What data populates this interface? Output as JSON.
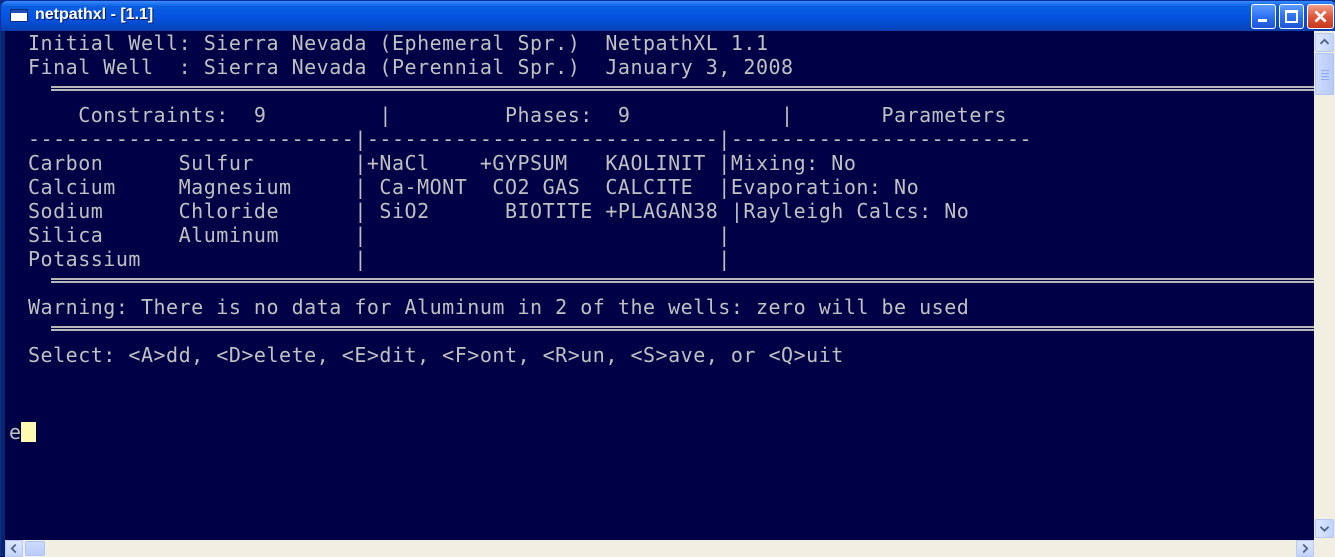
{
  "window": {
    "title": "netpathxl - [1.1]"
  },
  "console": {
    "lines": [
      "Initial Well: Sierra Nevada (Ephemeral Spr.)  NetpathXL 1.1",
      "Final Well  : Sierra Nevada (Perennial Spr.)  January 3, 2008",
      "=",
      "    Constraints:  9         |         Phases:  9            |       Parameters",
      "--------------------------|----------------------------|------------------------",
      "Carbon      Sulfur        |+NaCl    +GYPSUM   KAOLINIT |Mixing: No",
      "Calcium     Magnesium     | Ca-MONT  CO2 GAS  CALCITE  |Evaporation: No",
      "Sodium      Chloride      | SiO2      BIOTITE +PLAGAN38 |Rayleigh Calcs: No",
      "Silica      Aluminum      |                            |",
      "Potassium                 |                            |",
      "=",
      "Warning: There is no data for Aluminum in 2 of the wells: zero will be used",
      "=",
      "Select: <A>dd, <D>elete, <E>dit, <F>ont, <R>un, <S>ave, or <Q>uit"
    ],
    "prompt_input": "e"
  },
  "icons": {
    "app": "console-window-icon",
    "minimize": "minimize-icon",
    "maximize": "maximize-icon",
    "close": "close-icon"
  },
  "colors": {
    "console_bg": "#000047",
    "console_text": "#C0C0C0",
    "titlebar": "#0554E3",
    "cursor": "#FFF8B0"
  }
}
